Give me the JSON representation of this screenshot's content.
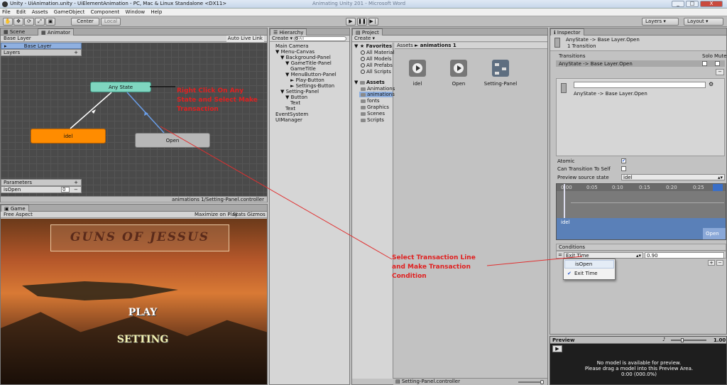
{
  "window": {
    "title": "Unity - UiAnimation.unity - UiElementAnimation - PC, Mac & Linux Standalone <DX11>",
    "faded_center": "Animating Unity 201 - Microsoft Word",
    "min": "_",
    "max": "□",
    "close": "X"
  },
  "menu": [
    "File",
    "Edit",
    "Assets",
    "GameObject",
    "Component",
    "Window",
    "Help"
  ],
  "toolbar": {
    "center": "Center",
    "local": "Local",
    "layers": "Layers",
    "layout": "Layout"
  },
  "scene_panel": {
    "tabs": [
      "Scene",
      "Animator"
    ],
    "base_layer_tab": "Base Layer",
    "auto_live_link": "Auto Live Link",
    "layers_header": "Layers",
    "layer_name": "Base Layer",
    "states": {
      "any": "Any State",
      "idel": "idel",
      "open": "Open"
    },
    "annotation": "Right Click On Any State and Select Make Transaction",
    "params_header": "Parameters",
    "param_name": "isOpen",
    "param_value": "0",
    "footer_path": "animations 1/Setting-Panel.controller"
  },
  "game_panel": {
    "tab": "Game",
    "aspect": "Free Aspect",
    "buttons": [
      "Maximize on Play",
      "Stats",
      "Gizmos"
    ],
    "game_title": "GUNS OF JESSUS",
    "play": "PLAY",
    "setting": "SETTING"
  },
  "hierarchy": {
    "tab": "Hierarchy",
    "create": "Create",
    "search": "All",
    "items": [
      {
        "label": "Main Camera",
        "indent": 0
      },
      {
        "label": "▼ Menu-Canvas",
        "indent": 0
      },
      {
        "label": "▼ Background-Panel",
        "indent": 1
      },
      {
        "label": "▼ GameTitle-Panel",
        "indent": 2
      },
      {
        "label": "GameTitle",
        "indent": 3
      },
      {
        "label": "▼ MenuButton-Panel",
        "indent": 2
      },
      {
        "label": "► Play-Button",
        "indent": 3
      },
      {
        "label": "► Settings-Button",
        "indent": 3
      },
      {
        "label": "▼ Setting-Panel",
        "indent": 1
      },
      {
        "label": "▼ Button",
        "indent": 2
      },
      {
        "label": "Text",
        "indent": 3
      },
      {
        "label": "Text",
        "indent": 2
      },
      {
        "label": "EventSystem",
        "indent": 0
      },
      {
        "label": "UIManager",
        "indent": 0
      }
    ]
  },
  "project": {
    "tab": "Project",
    "create": "Create",
    "breadcrumb_root": "Assets",
    "breadcrumb_sep": "►",
    "breadcrumb_leaf": "animations 1",
    "favorites_header": "Favorites",
    "favorites": [
      "All Material",
      "All Models",
      "All Prefabs",
      "All Scripts"
    ],
    "assets_header": "Assets",
    "folders": [
      "Animations",
      "animations",
      "fonts",
      "Graphics",
      "Scenes",
      "Scripts"
    ],
    "assets": [
      "idel",
      "Open",
      "Setting-Panel"
    ],
    "footer": "Setting-Panel.controller"
  },
  "inspector": {
    "tab": "Inspector",
    "title": "AnyState -> Base Layer.Open",
    "subtitle": "1 Transition",
    "transitions_header": "Transitions",
    "solo": "Solo",
    "mute": "Mute",
    "transition_row": "AnyState -> Base Layer.Open",
    "detail_label": "AnyState -> Base Layer.Open",
    "atomic_label": "Atomic",
    "can_self_label": "Can Transition To Self",
    "preview_source_label": "Preview source state",
    "preview_source_value": "idel",
    "timeline_ticks": [
      "0:00",
      "0:05",
      "0:10",
      "0:15",
      "0:20",
      "0:25"
    ],
    "timeline_idel": "idel",
    "timeline_open": "Open",
    "conditions_header": "Conditions",
    "condition_param": "Exit Time",
    "condition_value": "0.90",
    "dropdown_options": [
      "isOpen",
      "Exit Time"
    ],
    "checked_mark": "✔",
    "annotation": "Select Transaction Line and Make Transaction Condition",
    "preview_tab": "Preview",
    "preview_value": "1.00",
    "preview_msg1": "No model is available for preview.",
    "preview_msg2": "Please drag a model into this Preview Area.",
    "preview_msg3": "0:00 (000.0%)"
  }
}
